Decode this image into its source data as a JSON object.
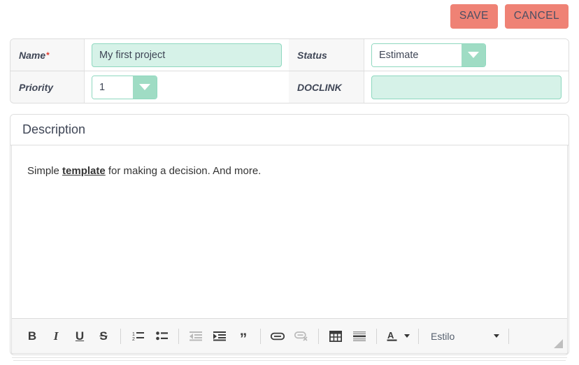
{
  "colors": {
    "accent_button": "#ef8275",
    "field_fill": "#d6f2e8",
    "field_border": "#8ed8bf",
    "dropdown_arrow": "#9fdcc4",
    "required_star": "#e03b2f",
    "panel_border": "#dddddd",
    "label_cell_bg": "#f7f7f7",
    "toolbar_bg": "#f7f7f7"
  },
  "action_bar": {
    "save_label": "SAVE",
    "cancel_label": "CANCEL"
  },
  "form": {
    "rows": [
      {
        "name_label": "Name",
        "required_marker": "*",
        "name_value": "My first project",
        "status_label": "Status",
        "status_value": "Estimate"
      },
      {
        "priority_label": "Priority",
        "priority_value": "1",
        "doclink_label": "DOCLINK",
        "doclink_value": ""
      }
    ]
  },
  "description": {
    "heading": "Description",
    "text_before": "Simple ",
    "text_link": "template",
    "text_after": " for making a decision. And more."
  },
  "toolbar": {
    "buttons": [
      {
        "name": "bold",
        "glyph": "B",
        "disabled": false
      },
      {
        "name": "italic",
        "glyph": "I",
        "disabled": false
      },
      {
        "name": "underline",
        "glyph": "U",
        "disabled": false
      },
      {
        "name": "strikethrough",
        "glyph": "S",
        "disabled": false
      },
      {
        "name": "numbered-list",
        "glyph": "",
        "disabled": false
      },
      {
        "name": "bulleted-list",
        "glyph": "",
        "disabled": false
      },
      {
        "name": "outdent",
        "glyph": "",
        "disabled": true
      },
      {
        "name": "indent",
        "glyph": "",
        "disabled": false
      },
      {
        "name": "blockquote",
        "glyph": "”",
        "disabled": false
      },
      {
        "name": "insert-link",
        "glyph": "",
        "disabled": false
      },
      {
        "name": "remove-link",
        "glyph": "",
        "disabled": true
      },
      {
        "name": "insert-table",
        "glyph": "",
        "disabled": false
      },
      {
        "name": "horizontal-rule",
        "glyph": "",
        "disabled": false
      },
      {
        "name": "text-color",
        "glyph": "A",
        "disabled": false
      }
    ],
    "style_label": "Estilo"
  }
}
